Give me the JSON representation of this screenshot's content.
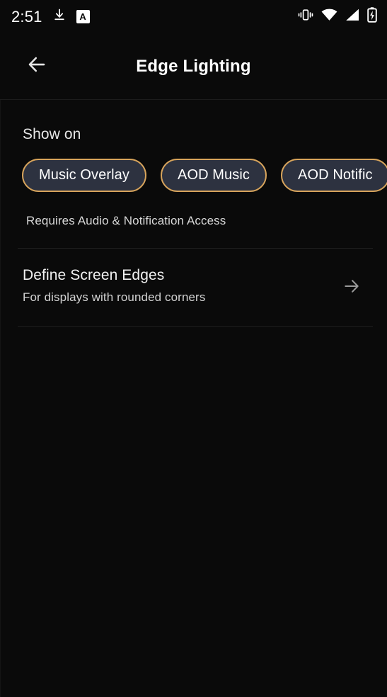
{
  "status_bar": {
    "time": "2:51",
    "left_icons": [
      {
        "name": "download-icon",
        "glyph": "download"
      },
      {
        "name": "a-badge-icon",
        "glyph": "A"
      }
    ],
    "right_icons": [
      {
        "name": "vibrate-icon",
        "glyph": "vibrate"
      },
      {
        "name": "wifi-icon",
        "glyph": "wifi"
      },
      {
        "name": "cellular-signal-icon",
        "glyph": "signal"
      },
      {
        "name": "battery-charging-icon",
        "glyph": "battery-charging"
      }
    ]
  },
  "app_bar": {
    "title": "Edge Lighting",
    "back_icon": "arrow-left-icon"
  },
  "sections": {
    "show_on": {
      "label": "Show on",
      "chips": [
        {
          "label": "Music Overlay",
          "selected": true
        },
        {
          "label": "AOD Music",
          "selected": true
        },
        {
          "label": "AOD Notific",
          "selected": true,
          "truncated": true
        }
      ],
      "hint": "Requires Audio & Notification Access"
    },
    "define_edges": {
      "title": "Define Screen Edges",
      "subtitle": "For displays with rounded corners",
      "chevron_icon": "arrow-right-icon"
    }
  },
  "colors": {
    "background": "#0a0a0a",
    "chip_border": "#d7a45c",
    "chip_fill": "#2d3240",
    "text_primary": "#ffffff",
    "text_secondary": "#d2d2d2",
    "divider": "#1f1f1f"
  }
}
